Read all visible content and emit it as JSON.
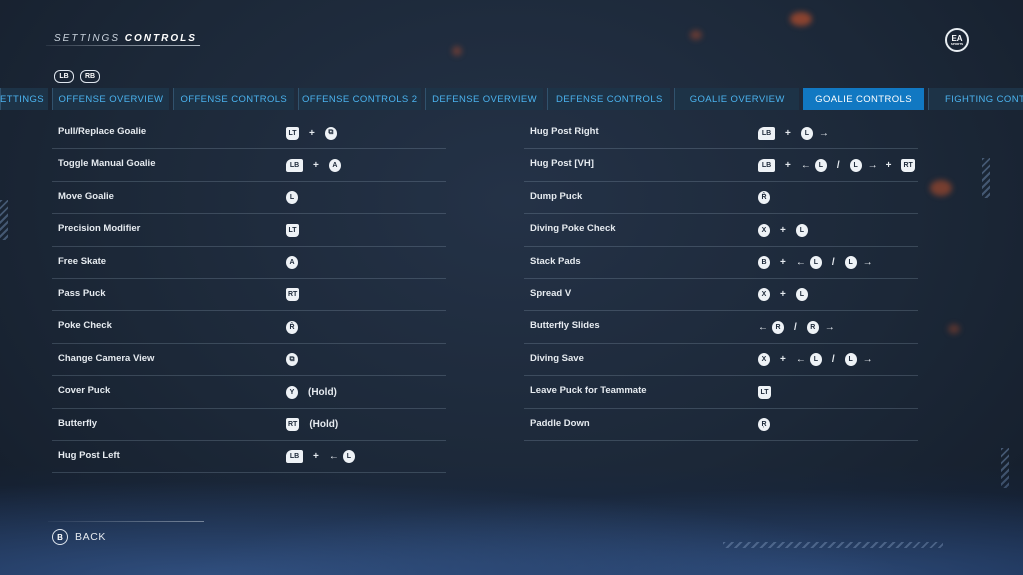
{
  "header": {
    "title_prefix": "SETTINGS",
    "title_main": "CONTROLS",
    "logo_top": "EA",
    "logo_bottom": "SPORTS"
  },
  "bumpers": {
    "left": "LB",
    "right": "RB"
  },
  "tabs": [
    {
      "label": "SETTINGS",
      "active": false
    },
    {
      "label": "OFFENSE OVERVIEW",
      "active": false
    },
    {
      "label": "OFFENSE CONTROLS",
      "active": false
    },
    {
      "label": "OFFENSE CONTROLS 2",
      "active": false
    },
    {
      "label": "DEFENSE OVERVIEW",
      "active": false
    },
    {
      "label": "DEFENSE CONTROLS",
      "active": false
    },
    {
      "label": "GOALIE OVERVIEW",
      "active": false
    },
    {
      "label": "GOALIE CONTROLS",
      "active": true
    },
    {
      "label": "FIGHTING CONTROLS",
      "active": false
    }
  ],
  "left_controls": [
    {
      "label": "Pull/Replace Goalie",
      "combo": [
        {
          "k": "btn",
          "v": "LT",
          "s": "trigger"
        },
        {
          "k": "sep",
          "v": "+"
        },
        {
          "k": "btn",
          "v": "⧉",
          "s": "circle"
        }
      ]
    },
    {
      "label": "Toggle Manual Goalie",
      "combo": [
        {
          "k": "btn",
          "v": "LB",
          "s": "bumper"
        },
        {
          "k": "sep",
          "v": "+"
        },
        {
          "k": "btn",
          "v": "A",
          "s": "circle"
        }
      ]
    },
    {
      "label": "Move Goalie",
      "combo": [
        {
          "k": "btn",
          "v": "L",
          "s": "circle"
        }
      ]
    },
    {
      "label": "Precision Modifier",
      "combo": [
        {
          "k": "btn",
          "v": "LT",
          "s": "trigger"
        }
      ]
    },
    {
      "label": "Free Skate",
      "combo": [
        {
          "k": "btn",
          "v": "A",
          "s": "circle"
        }
      ]
    },
    {
      "label": "Pass Puck",
      "combo": [
        {
          "k": "btn",
          "v": "RT",
          "s": "trigger"
        }
      ]
    },
    {
      "label": "Poke Check",
      "combo": [
        {
          "k": "btn",
          "v": "R̂",
          "s": "circle"
        }
      ]
    },
    {
      "label": "Change Camera View",
      "combo": [
        {
          "k": "btn",
          "v": "⧉",
          "s": "circle"
        }
      ]
    },
    {
      "label": "Cover Puck",
      "combo": [
        {
          "k": "btn",
          "v": "Y",
          "s": "circle"
        },
        {
          "k": "hold",
          "v": "(Hold)"
        }
      ]
    },
    {
      "label": "Butterfly",
      "combo": [
        {
          "k": "btn",
          "v": "RT",
          "s": "trigger"
        },
        {
          "k": "hold",
          "v": "(Hold)"
        }
      ]
    },
    {
      "label": "Hug Post Left",
      "combo": [
        {
          "k": "btn",
          "v": "LB",
          "s": "bumper"
        },
        {
          "k": "sep",
          "v": "+"
        },
        {
          "k": "dir",
          "v": "←"
        },
        {
          "k": "btn",
          "v": "L",
          "s": "circle"
        }
      ]
    }
  ],
  "right_controls": [
    {
      "label": "Hug Post Right",
      "combo": [
        {
          "k": "btn",
          "v": "LB",
          "s": "bumper"
        },
        {
          "k": "sep",
          "v": "+"
        },
        {
          "k": "btn",
          "v": "L",
          "s": "circle"
        },
        {
          "k": "dir",
          "v": "→"
        }
      ]
    },
    {
      "label": "Hug Post [VH]",
      "combo": [
        {
          "k": "btn",
          "v": "LB",
          "s": "bumper"
        },
        {
          "k": "sep",
          "v": "+"
        },
        {
          "k": "dir",
          "v": "←"
        },
        {
          "k": "btn",
          "v": "L",
          "s": "circle"
        },
        {
          "k": "sep",
          "v": "/"
        },
        {
          "k": "btn",
          "v": "L",
          "s": "circle"
        },
        {
          "k": "dir",
          "v": "→"
        },
        {
          "k": "sep",
          "v": "+"
        },
        {
          "k": "btn",
          "v": "RT",
          "s": "trigger"
        }
      ]
    },
    {
      "label": "Dump Puck",
      "combo": [
        {
          "k": "btn",
          "v": "R̂",
          "s": "circle"
        }
      ]
    },
    {
      "label": "Diving Poke Check",
      "combo": [
        {
          "k": "btn",
          "v": "X",
          "s": "circle"
        },
        {
          "k": "sep",
          "v": "+"
        },
        {
          "k": "btn",
          "v": "L",
          "s": "circle"
        }
      ]
    },
    {
      "label": "Stack Pads",
      "combo": [
        {
          "k": "btn",
          "v": "B",
          "s": "circle"
        },
        {
          "k": "sep",
          "v": "+"
        },
        {
          "k": "dir",
          "v": "←"
        },
        {
          "k": "btn",
          "v": "L",
          "s": "circle"
        },
        {
          "k": "sep",
          "v": "/"
        },
        {
          "k": "btn",
          "v": "L",
          "s": "circle"
        },
        {
          "k": "dir",
          "v": "→"
        }
      ]
    },
    {
      "label": "Spread V",
      "combo": [
        {
          "k": "btn",
          "v": "X",
          "s": "circle"
        },
        {
          "k": "sep",
          "v": "+"
        },
        {
          "k": "btn",
          "v": "L",
          "s": "circle"
        }
      ]
    },
    {
      "label": "Butterfly Slides",
      "combo": [
        {
          "k": "dir",
          "v": "←"
        },
        {
          "k": "btn",
          "v": "R",
          "s": "circle"
        },
        {
          "k": "sep",
          "v": "/"
        },
        {
          "k": "btn",
          "v": "R",
          "s": "circle"
        },
        {
          "k": "dir",
          "v": "→"
        }
      ]
    },
    {
      "label": "Diving Save",
      "combo": [
        {
          "k": "btn",
          "v": "X",
          "s": "circle"
        },
        {
          "k": "sep",
          "v": "+"
        },
        {
          "k": "dir",
          "v": "←"
        },
        {
          "k": "btn",
          "v": "L",
          "s": "circle"
        },
        {
          "k": "sep",
          "v": "/"
        },
        {
          "k": "btn",
          "v": "L",
          "s": "circle"
        },
        {
          "k": "dir",
          "v": "→"
        }
      ]
    },
    {
      "label": "Leave Puck for Teammate",
      "combo": [
        {
          "k": "btn",
          "v": "LT",
          "s": "trigger"
        }
      ]
    },
    {
      "label": "Paddle Down",
      "combo": [
        {
          "k": "btn",
          "v": "R̩",
          "s": "circle"
        }
      ]
    }
  ],
  "footer": {
    "back_button": "B",
    "back_label": "BACK"
  },
  "colors": {
    "tab_text": "#4bb3ef",
    "tab_active_bg": "#1178c2",
    "background": "#1c2838"
  }
}
